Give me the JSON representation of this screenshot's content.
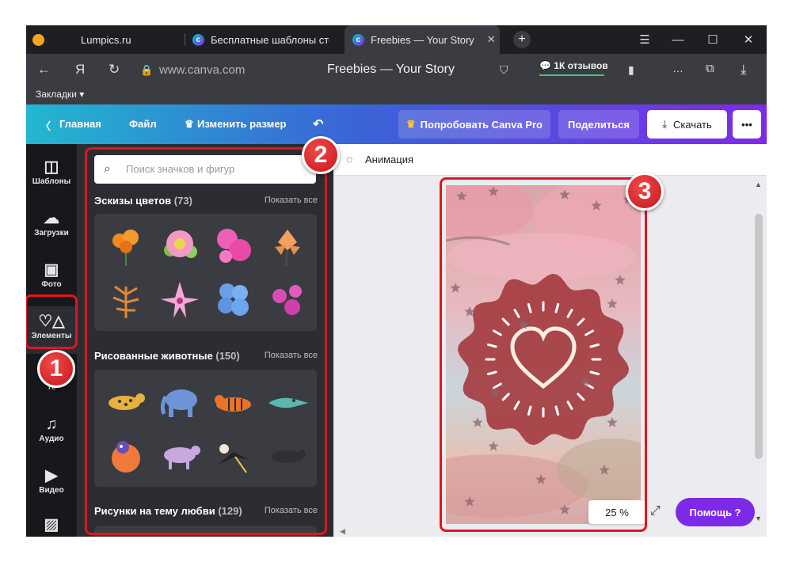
{
  "browser": {
    "tabs": [
      {
        "label": "Lumpics.ru"
      },
      {
        "label": "Бесплатные шаблоны сто"
      },
      {
        "label": "Freebies — Your Story"
      }
    ],
    "new_tab": "+",
    "address": {
      "url": "www.canva.com",
      "page_title": "Freebies — Your Story",
      "reviews": "1К отзывов",
      "yandex_glyph": "Я"
    },
    "bookmarks_label": "Закладки ▾"
  },
  "canva_header": {
    "home": "Главная",
    "file": "Файл",
    "resize": "Изменить размер",
    "try_pro": "Попробовать Canva Pro",
    "share": "Поделиться",
    "download": "Скачать",
    "more": "•••"
  },
  "nav": {
    "items": [
      {
        "label": "Шаблоны",
        "icon": "templates-icon"
      },
      {
        "label": "Загрузки",
        "icon": "uploads-icon"
      },
      {
        "label": "Фото",
        "icon": "photos-icon"
      },
      {
        "label": "Элементы",
        "icon": "elements-icon"
      },
      {
        "label": "Те",
        "icon": "text-icon"
      },
      {
        "label": "Аудио",
        "icon": "audio-icon"
      },
      {
        "label": "Видео",
        "icon": "video-icon"
      }
    ]
  },
  "panel": {
    "search_placeholder": "Поиск значков и фигур",
    "sections": [
      {
        "title": "Эскизы цветов",
        "count": "(73)",
        "show_all": "Показать все"
      },
      {
        "title": "Рисованные животные",
        "count": "(150)",
        "show_all": "Показать все"
      },
      {
        "title": "Рисунки на тему любви",
        "count": "(129)",
        "show_all": "Показать все"
      }
    ]
  },
  "editor": {
    "animation_label": "Анимация",
    "zoom": "25 %",
    "help": "Помощь ?"
  },
  "annotations": {
    "badges": [
      "1",
      "2",
      "3"
    ],
    "highlight_color": "#e3141e"
  },
  "colors": {
    "brand_purple": "#7d2ae8",
    "brand_cyan": "#22b7cf",
    "panel_bg": "#2b2d33",
    "badge_wavy": "#a33a3e"
  }
}
